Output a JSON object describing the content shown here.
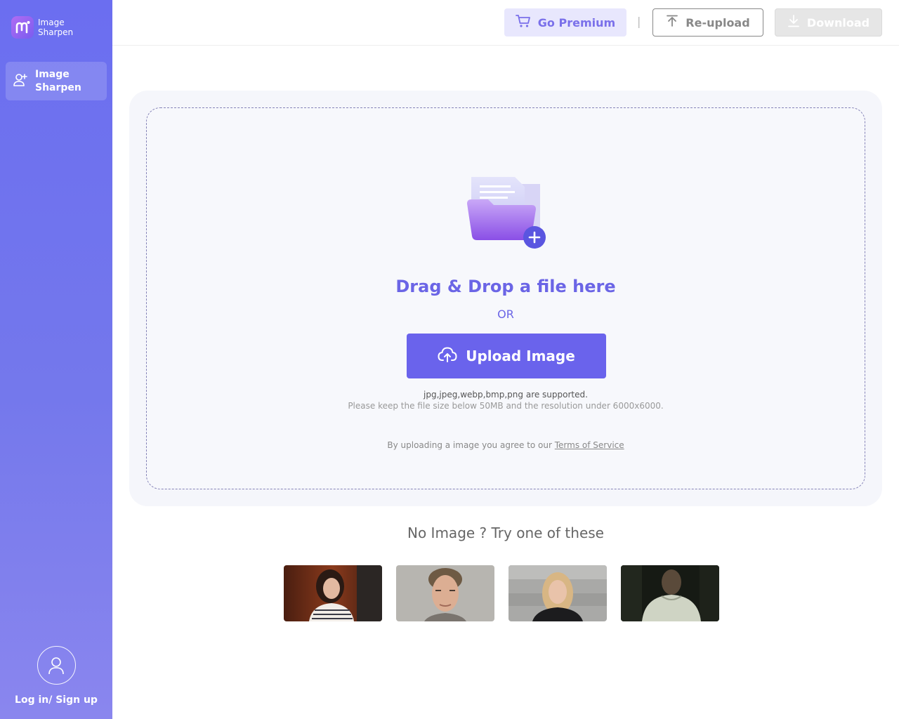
{
  "app": {
    "logo_line1": "Image",
    "logo_line2": "Sharpen"
  },
  "sidebar": {
    "nav_item_label": "Image Sharpen",
    "login_label": "Log in/ Sign up"
  },
  "header": {
    "premium_label": "Go Premium",
    "divider": "|",
    "reupload_label": "Re-upload",
    "download_label": "Download"
  },
  "upload": {
    "title": "Drag & Drop a file here",
    "or": "OR",
    "button_label": "Upload Image",
    "supported": "jpg,jpeg,webp,bmp,png are supported.",
    "limits": "Please keep the file size below 50MB and the resolution under 6000x6000.",
    "terms_prefix": "By uploading a image you agree to our ",
    "terms_link": "Terms of Service"
  },
  "samples": {
    "title": "No Image ? Try one of these",
    "items": [
      "sample-woman-striped-top",
      "sample-man-grey-background",
      "sample-woman-black-top",
      "sample-man-dark-scene"
    ]
  },
  "colors": {
    "accent": "#6a63ec",
    "sidebar_top": "#6b6ef0",
    "sidebar_bottom": "#8a86ee"
  }
}
